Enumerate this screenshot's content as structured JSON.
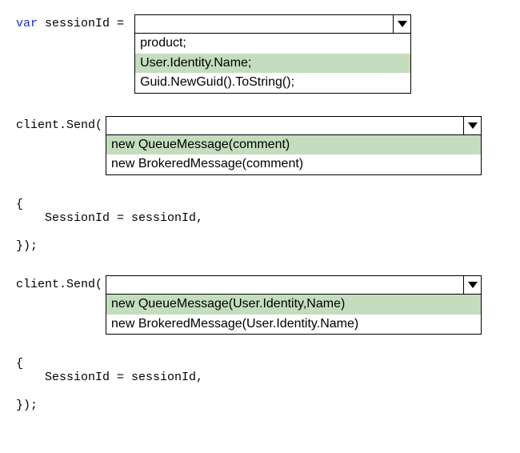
{
  "line1": {
    "keyword": "var",
    "rest": " sessionId ="
  },
  "dropdown1": {
    "value": "",
    "options": [
      {
        "text": "product;",
        "selected": false
      },
      {
        "text": "User.Identity.Name;",
        "selected": true
      },
      {
        "text": "Guid.NewGuid().ToString();",
        "selected": false
      }
    ]
  },
  "line2": {
    "text": "client.Send("
  },
  "dropdown2": {
    "value": "",
    "options": [
      {
        "text": "new QueueMessage(comment)",
        "selected": true
      },
      {
        "text": "new BrokeredMessage(comment)",
        "selected": false
      }
    ]
  },
  "block1": {
    "open": "{",
    "body": "SessionId = sessionId,",
    "close": "});"
  },
  "line3": {
    "text": "client.Send("
  },
  "dropdown3": {
    "value": "",
    "options": [
      {
        "text": "new QueueMessage(User.Identity,Name)",
        "selected": true
      },
      {
        "text": "new BrokeredMessage(User.Identity.Name)",
        "selected": false
      }
    ]
  },
  "block2": {
    "open": "{",
    "body": "SessionId = sessionId,",
    "close": "});"
  }
}
